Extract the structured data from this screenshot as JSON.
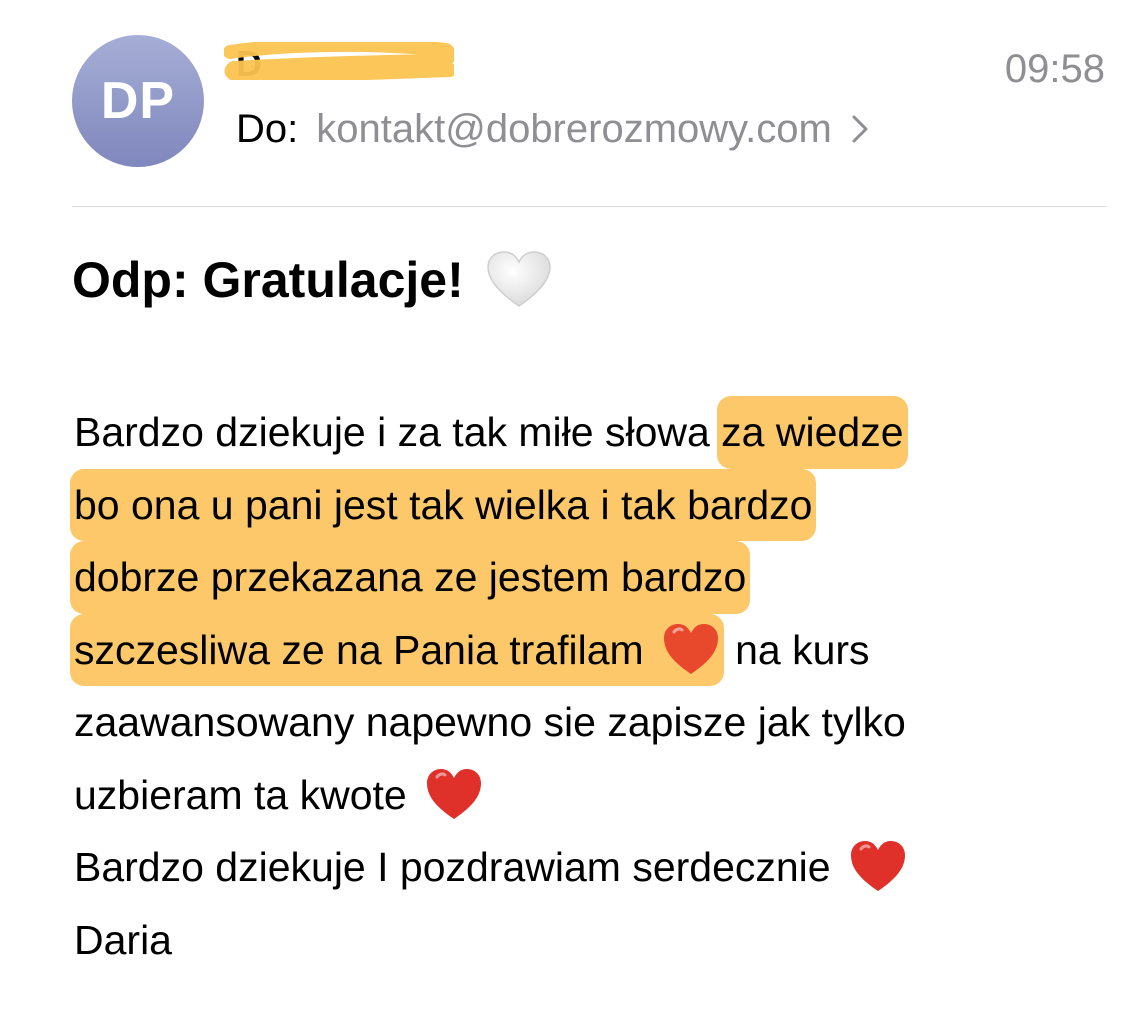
{
  "header": {
    "avatar_initials": "DP",
    "sender_name": "D",
    "time": "09:58",
    "to_label": "Do:",
    "to_address": "kontakt@dobrerozmowy.com"
  },
  "subject": "Odp: Gratulacje!",
  "body": {
    "line1_plain": "Bardzo dziekuje i za tak miłe słowa ",
    "line1_hl": "za wiedze",
    "line2_hl": "bo ona u pani jest tak wielka i tak bardzo",
    "line3_hl": "dobrze przekazana ze jestem bardzo",
    "line4_hl": "szczesliwa ze na Pania trafilam",
    "line4_plain": " na kurs",
    "line5": "zaawansowany napewno sie zapisze jak tylko",
    "line6": "uzbieram ta kwote",
    "line7": "Bardzo dziekuje I pozdrawiam serdecznie",
    "signature": "Daria"
  },
  "colors": {
    "avatar_top": "#a6aed6",
    "avatar_bottom": "#7f87bd",
    "highlight": "#fdc86a",
    "secondary_text": "#8e8e93",
    "heart_red": "#e0302a"
  },
  "icons": {
    "subject_icon": "white-heart-icon",
    "body_icon": "red-heart-icon",
    "recipient_icon": "chevron-right-icon"
  }
}
